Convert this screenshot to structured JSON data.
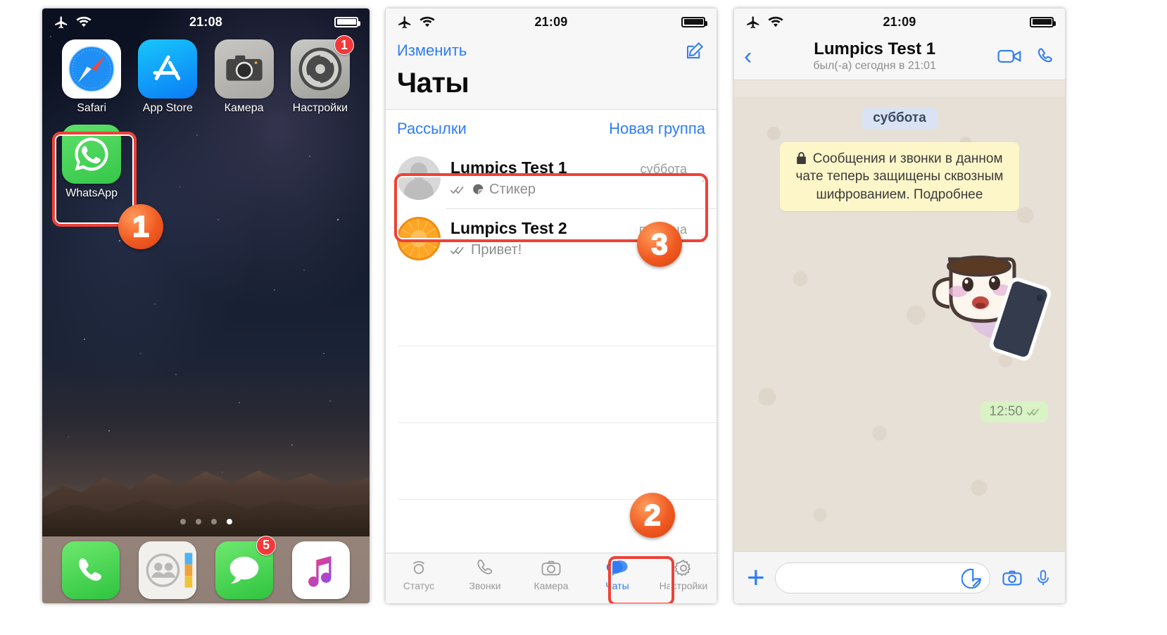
{
  "phone1": {
    "name": "ios-home-screen",
    "status_bar": {
      "time": "21:08",
      "airplane_icon": "airplane-mode-icon",
      "wifi_icon": "wifi-icon",
      "battery_icon": "battery-full-icon"
    },
    "apps": [
      {
        "label": "Safari",
        "icon": "safari-icon",
        "badge": ""
      },
      {
        "label": "App Store",
        "icon": "app-store-icon",
        "badge": ""
      },
      {
        "label": "Камера",
        "icon": "camera-icon",
        "badge": ""
      },
      {
        "label": "Настройки",
        "icon": "settings-gear-icon",
        "badge": "1"
      },
      {
        "label": "WhatsApp",
        "icon": "whatsapp-icon",
        "badge": ""
      }
    ],
    "page_dots": {
      "count": 4,
      "active_index": 3
    },
    "dock": [
      {
        "label": "Телефон",
        "icon": "phone-handset-icon",
        "badge": ""
      },
      {
        "label": "Контакты",
        "icon": "contacts-icon",
        "badge": ""
      },
      {
        "label": "Сообщения",
        "icon": "messages-bubble-icon",
        "badge": "5"
      },
      {
        "label": "Музыка",
        "icon": "music-note-icon",
        "badge": ""
      }
    ],
    "callout": "1"
  },
  "phone2": {
    "name": "whatsapp-chats-list",
    "status_bar": {
      "time": "21:09",
      "airplane_icon": "airplane-mode-icon",
      "wifi_icon": "wifi-icon",
      "battery_icon": "battery-full-icon"
    },
    "nav": {
      "edit_label": "Изменить",
      "compose_icon": "compose-pencil-icon",
      "title": "Чаты"
    },
    "subrow": {
      "broadcast_label": "Рассылки",
      "new_group_label": "Новая группа"
    },
    "chats": [
      {
        "name": "Lumpics Test 1",
        "date": "суббота",
        "preview": "Стикер",
        "status_icon": "double-check-icon",
        "preview_icon": "sticker-icon",
        "avatar": "default-person-avatar",
        "chevron": "chevron-right-icon"
      },
      {
        "name": "Lumpics Test 2",
        "date": "пятница",
        "preview": "Привет!",
        "status_icon": "double-check-icon",
        "preview_icon": "",
        "avatar": "orange-slice-avatar",
        "chevron": "chevron-right-icon"
      }
    ],
    "tabs": [
      {
        "label": "Статус",
        "icon": "status-rings-icon",
        "active": false
      },
      {
        "label": "Звонки",
        "icon": "phone-handset-icon",
        "active": false
      },
      {
        "label": "Камера",
        "icon": "camera-icon",
        "active": false
      },
      {
        "label": "Чаты",
        "icon": "chat-bubbles-icon",
        "active": true
      },
      {
        "label": "Настройки",
        "icon": "settings-gear-icon",
        "active": false
      }
    ],
    "callout_tab": "2",
    "callout_chat": "3"
  },
  "phone3": {
    "name": "whatsapp-conversation",
    "status_bar": {
      "time": "21:09",
      "airplane_icon": "airplane-mode-icon",
      "wifi_icon": "wifi-icon",
      "battery_icon": "battery-full-icon"
    },
    "nav": {
      "back_icon": "chevron-left-icon",
      "peer_name": "Lumpics Test 1",
      "peer_status": "был(-а) сегодня в 21:01",
      "video_call_icon": "video-camera-icon",
      "voice_call_icon": "phone-handset-icon"
    },
    "day_pill": "суббота",
    "encryption_notice": {
      "lock_icon": "lock-icon",
      "text": "Сообщения и звонки в данном чате теперь защищены сквозным шифрованием. Подробнее"
    },
    "message": {
      "type": "sticker",
      "sticker_icon": "coffee-cup-with-phone-sticker",
      "time": "12:50",
      "status_icon": "double-check-icon"
    },
    "input_bar": {
      "attach_icon": "plus-icon",
      "placeholder": "",
      "value": "",
      "sticker_icon": "sticker-icon",
      "camera_icon": "camera-icon",
      "mic_icon": "microphone-icon"
    }
  },
  "colors": {
    "ios_blue": "#2f7cf6",
    "whatsapp_green": "#35c74a",
    "callout_red": "#ef4136",
    "badge_orange": "#f05a22",
    "notice_yellow": "#fdf6c9",
    "day_pill_blue": "#d9e3f3",
    "bubble_green": "#d9f2c6"
  }
}
